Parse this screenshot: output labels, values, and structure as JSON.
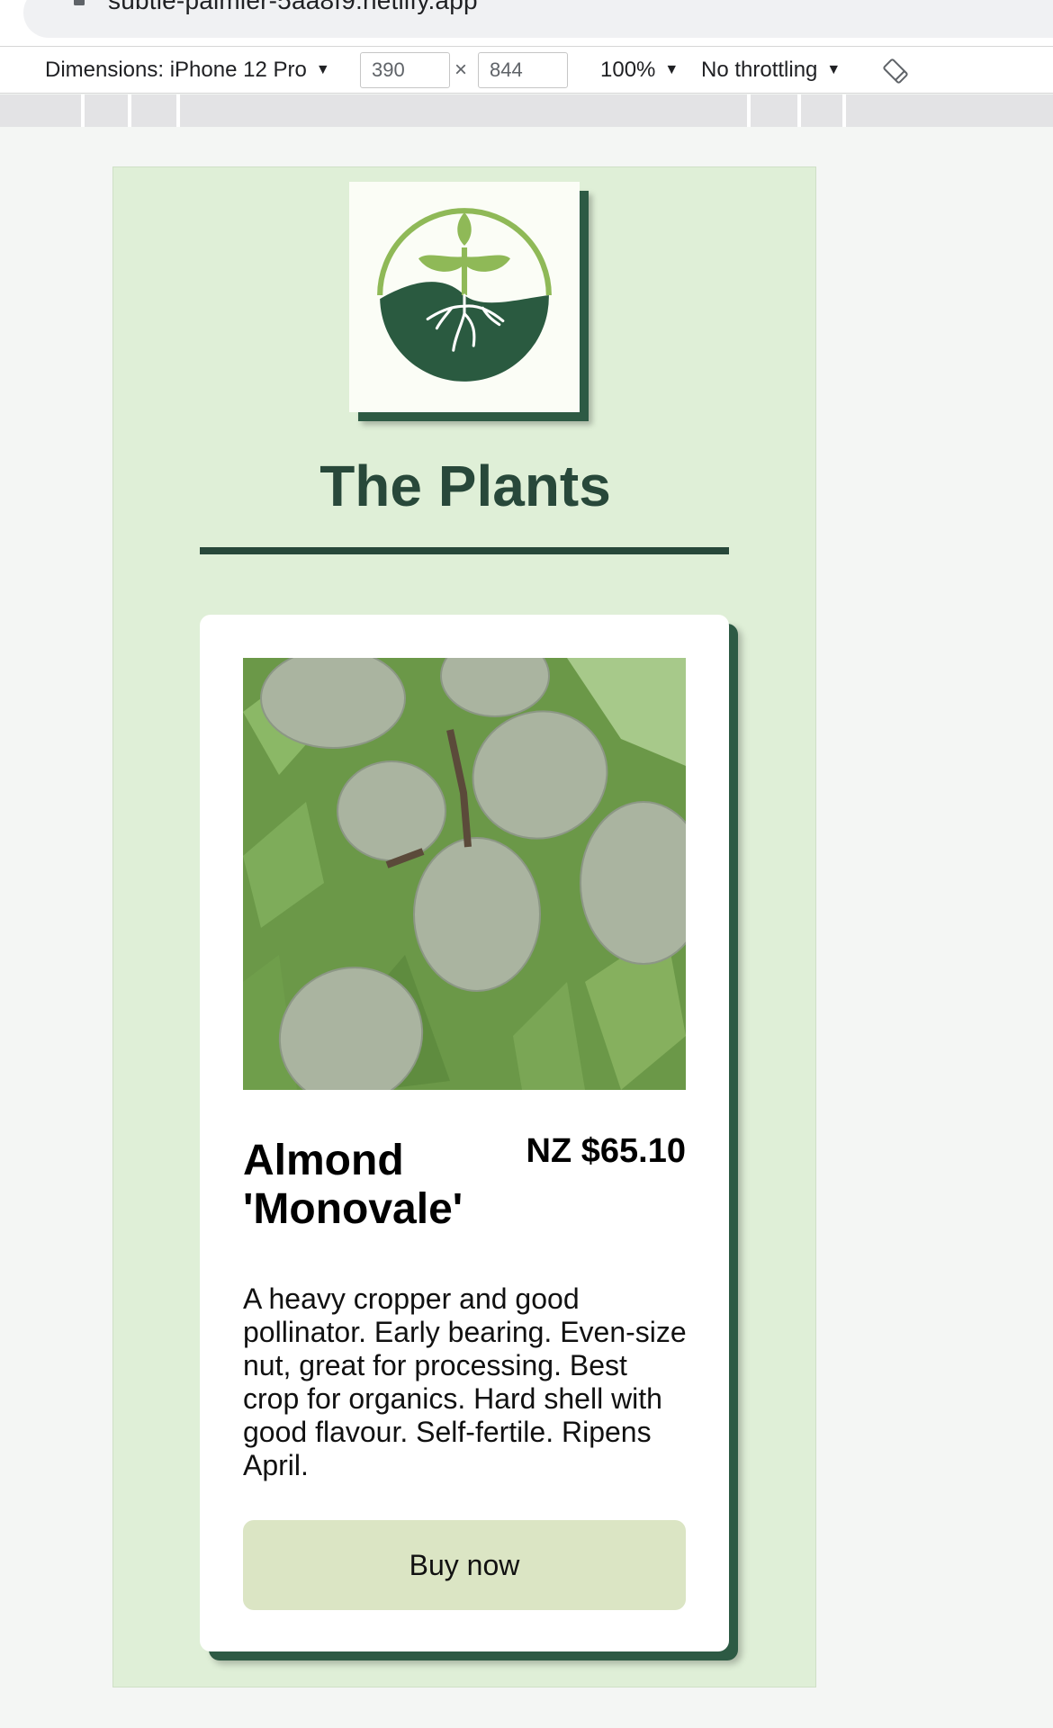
{
  "browser": {
    "url": "subtle-palmier-5aa8f9.netlify.app"
  },
  "devtools": {
    "dimensions_label": "Dimensions: iPhone 12 Pro",
    "width_value": "390",
    "height_value": "844",
    "times_symbol": "×",
    "zoom": "100%",
    "throttling": "No throttling",
    "caret": "▼"
  },
  "page": {
    "site_title": "The Plants",
    "product": {
      "name": "Almond 'Monovale'",
      "price": "NZ $65.10",
      "description": "A heavy cropper and good pollinator. Early bearing. Even-size nut, great for processing. Best crop for organics. Hard shell with good flavour. Self-fertile. Ripens April.",
      "button_label": "Buy now"
    }
  },
  "colors": {
    "panel_bg": "#dfefd7",
    "brand_dark": "#28483a",
    "button_bg": "#dbe5c4",
    "logo_leaf": "#8fb957"
  },
  "icons": [
    "lock-icon",
    "dropdown-caret-icon",
    "rotate-device-icon",
    "plant-logo-icon"
  ]
}
